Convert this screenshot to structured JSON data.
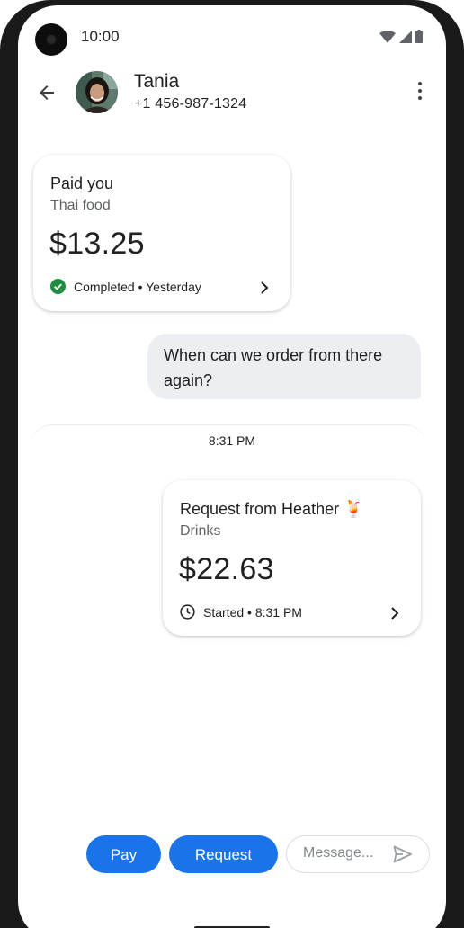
{
  "status_bar": {
    "time": "10:00"
  },
  "header": {
    "contact_name": "Tania",
    "contact_phone": "+1 456-987-1324"
  },
  "messages": {
    "payment_card": {
      "title": "Paid you",
      "subtitle": "Thai food",
      "amount": "$13.25",
      "status": "Completed • Yesterday"
    },
    "bubble_text": "When can we order from there again?",
    "divider_time": "8:31 PM",
    "request_card": {
      "title": "Request from Heather 🍹",
      "subtitle": "Drinks",
      "amount": "$22.63",
      "status": "Started • 8:31 PM"
    }
  },
  "composer": {
    "pay_label": "Pay",
    "request_label": "Request",
    "message_placeholder": "Message..."
  },
  "colors": {
    "accent": "#1a73e8",
    "success": "#1e8e3e",
    "bubble": "#eceef1"
  }
}
